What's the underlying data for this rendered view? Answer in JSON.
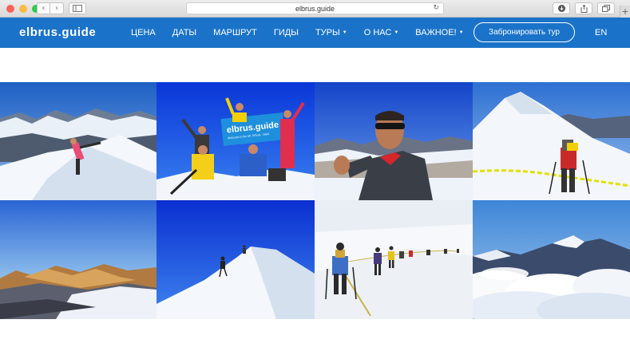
{
  "browser": {
    "url": "elbrus.guide",
    "traffic_light_colors": [
      "#fc605c",
      "#fdbc40",
      "#34c84a"
    ],
    "icons": [
      "back-icon",
      "forward-icon",
      "sidebar-icon",
      "reload-icon",
      "download-icon",
      "share-icon",
      "tabs-icon",
      "new-tab-icon"
    ]
  },
  "site": {
    "logo": "elbrus.guide",
    "brand_color": "#1a73c8",
    "menu": [
      {
        "label": "ЦЕНА"
      },
      {
        "label": "ДАТЫ"
      },
      {
        "label": "МАРШРУТ"
      },
      {
        "label": "ГИДЫ"
      },
      {
        "label": "ТУРЫ",
        "dropdown": true
      },
      {
        "label": "О НАС",
        "dropdown": true
      },
      {
        "label": "ВАЖНОЕ!",
        "dropdown": true
      }
    ],
    "book_button": "Забронировать тур",
    "language": "EN"
  },
  "gallery": {
    "photos": [
      {
        "subject": "climber-on-snow-ridge"
      },
      {
        "subject": "group-with-banner-on-summit",
        "banner_text": "elbrus.guide",
        "banner_subtext": "Welcome to the Mt. El'brus · 5642"
      },
      {
        "subject": "guide-portrait-pointing"
      },
      {
        "subject": "climber-on-roped-slope"
      },
      {
        "subject": "sunset-mountain-range"
      },
      {
        "subject": "climbers-on-summit-ridge"
      },
      {
        "subject": "rope-team-ascending"
      },
      {
        "subject": "peaks-above-clouds"
      }
    ]
  }
}
